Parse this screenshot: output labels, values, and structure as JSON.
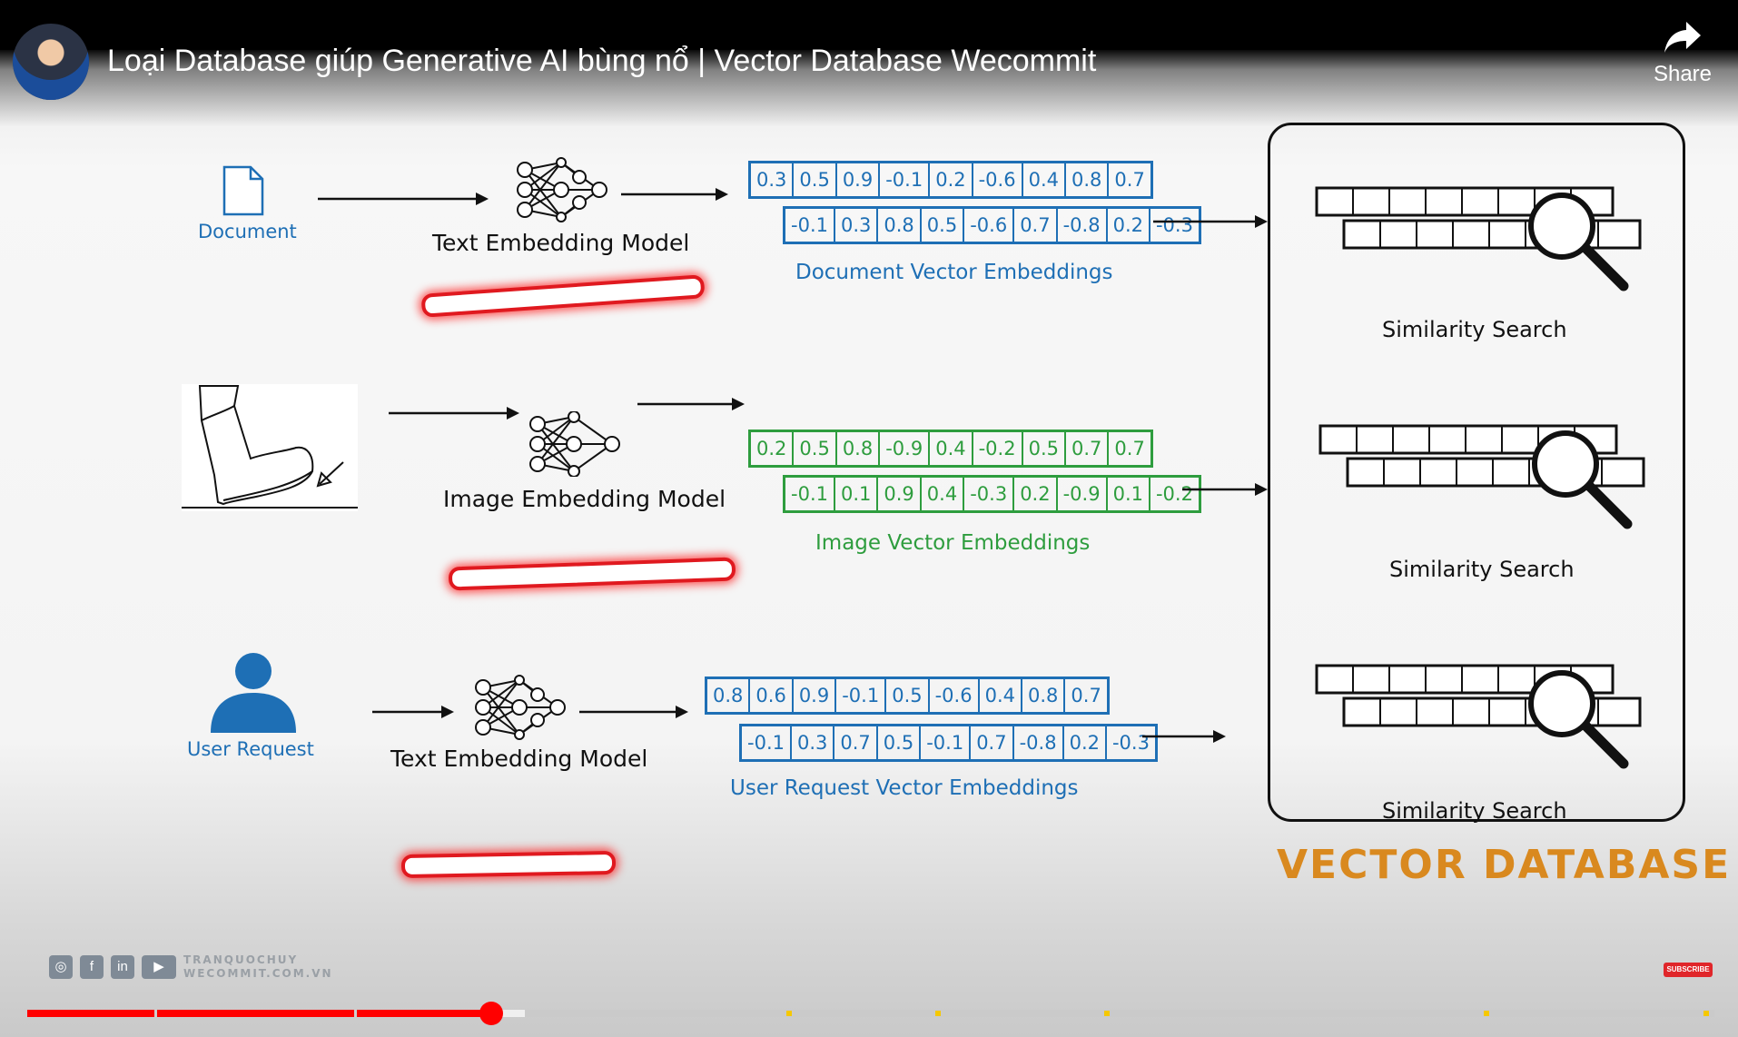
{
  "video": {
    "title": "Loại Database giúp Generative AI bùng nổ | Vector Database Wecommit",
    "share_label": "Share",
    "progress_played": 0.275,
    "progress_buffered": 0.295
  },
  "diagram": {
    "rows": [
      {
        "input_label": "Document",
        "model_label": "Text Embedding Model",
        "vector1": [
          "0.3",
          "0.5",
          "0.9",
          "-0.1",
          "0.2",
          "-0.6",
          "0.4",
          "0.8",
          "0.7"
        ],
        "vector2": [
          "-0.1",
          "0.3",
          "0.8",
          "0.5",
          "-0.6",
          "0.7",
          "-0.8",
          "0.2",
          "-0.3"
        ],
        "vector_label": "Document Vector Embeddings"
      },
      {
        "input_label": "",
        "model_label": "Image Embedding Model",
        "vector1": [
          "0.2",
          "0.5",
          "0.8",
          "-0.9",
          "0.4",
          "-0.2",
          "0.5",
          "0.7",
          "0.7"
        ],
        "vector2": [
          "-0.1",
          "0.1",
          "0.9",
          "0.4",
          "-0.3",
          "0.2",
          "-0.9",
          "0.1",
          "-0.2"
        ],
        "vector_label": "Image Vector Embeddings"
      },
      {
        "input_label": "User Request",
        "model_label": "Text Embedding Model",
        "vector1": [
          "0.8",
          "0.6",
          "0.9",
          "-0.1",
          "0.5",
          "-0.6",
          "0.4",
          "0.8",
          "0.7"
        ],
        "vector2": [
          "-0.1",
          "0.3",
          "0.7",
          "0.5",
          "-0.1",
          "0.7",
          "-0.8",
          "0.2",
          "-0.3"
        ],
        "vector_label": "User Request Vector Embeddings"
      }
    ],
    "similarity_label": "Similarity Search",
    "database_label": "VECTOR DATABASE",
    "colors": {
      "blue": "#1e6fb5",
      "green": "#2e9d3e",
      "accent": "#d9891f",
      "highlight": "#e0191f"
    }
  },
  "brand": {
    "line1": "TRANQUOCHUY",
    "line2": "WECOMMIT.COM.VN",
    "icons": [
      "globe-icon",
      "facebook-icon",
      "linkedin-icon",
      "youtube-icon"
    ]
  },
  "subscribe_label": "SUBSCRIBE"
}
